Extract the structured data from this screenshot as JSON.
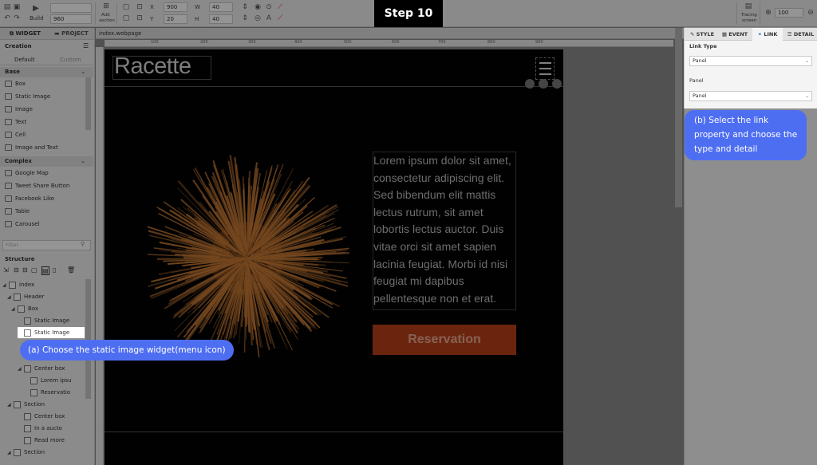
{
  "step": {
    "label": "Step 10"
  },
  "toolbar": {
    "build_label": "Build",
    "width_value": "960",
    "add_section_line1": "Add",
    "add_section_line2": "section",
    "x_label": "X",
    "x_value": "900",
    "w_label": "W",
    "w_value": "40",
    "y_label": "Y",
    "y_value": "20",
    "h_label": "H",
    "h_value": "40",
    "tracing_line1": "Tracing",
    "tracing_line2": "screen",
    "zoom_value": "100"
  },
  "left_tabs": {
    "widget": "WIDGET",
    "project": "PROJECT"
  },
  "creation": {
    "title": "Creation",
    "tab_default": "Default",
    "tab_custom": "Custom",
    "base_header": "Base",
    "base_items": [
      "Box",
      "Static Image",
      "Image",
      "Text",
      "Cell",
      "Image and Text"
    ],
    "complex_header": "Complex",
    "complex_items": [
      "Google Map",
      "Tweet Share Button",
      "Facebook Like",
      "Table",
      "Carousel"
    ],
    "filter_placeholder": "Filter"
  },
  "structure": {
    "title": "Structure",
    "items": [
      "index",
      "Header",
      "Box",
      "Static Image",
      "Static Image",
      "Center box",
      "Lorem ipsu",
      "Reservatio",
      "Section",
      "Center box",
      "In a aucto",
      "Read more",
      "Section"
    ]
  },
  "doc_tab": {
    "label": "index.webpage"
  },
  "ruler": {
    "marks": [
      "100",
      "200",
      "300",
      "400",
      "500",
      "600",
      "700",
      "800",
      "900"
    ]
  },
  "site": {
    "logo": "Racette",
    "body_text": "Lorem ipsum dolor sit amet, consectetur adipiscing elit. Sed bibendum elit mattis lectus rutrum, sit amet lobortis lectus auctor. Duis vitae orci sit amet sapien lacinia feugiat. Morbi id nisi feugiat mi dapibus pellentesque non et erat.",
    "button": "Reservation"
  },
  "right_tabs": {
    "style": "STYLE",
    "event": "EVENT",
    "link": "LINK",
    "detail": "DETAIL"
  },
  "link_panel": {
    "link_type_label": "Link Type",
    "link_type_value": "Panel",
    "panel_label": "Panel",
    "panel_value": "Panel"
  },
  "callouts": {
    "a": "(a) Choose the static image widget(menu icon)",
    "b": "(b) Select the link property and choose the type and detail"
  },
  "colors": {
    "accent": "#4e6ef2",
    "reservation": "#b8401a",
    "pasta": "#c87a35"
  }
}
